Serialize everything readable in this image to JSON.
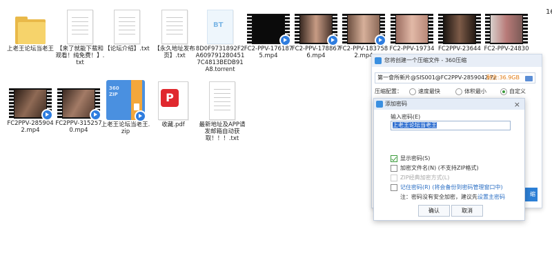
{
  "files": [
    {
      "name": "上老王论坛当老王",
      "type": "folder"
    },
    {
      "name": "【来了就能下载和观看！纯免费！】.txt",
      "type": "txt"
    },
    {
      "name": "【论坛介绍】.txt",
      "type": "txt"
    },
    {
      "name": "【永久地址发布页】.txt",
      "type": "txt"
    },
    {
      "name": "8D0F9731892F2A6097912804517C4813BEDB91A8.torrent",
      "type": "torrent"
    },
    {
      "name": "FC2-PPV-1761875.mp4",
      "type": "video"
    },
    {
      "name": "FC2-PPV-1788676.mp4",
      "type": "video"
    },
    {
      "name": "FC2-PPV-1837582.mp4",
      "type": "video"
    },
    {
      "name": "FC2-PPV-19734",
      "type": "video"
    },
    {
      "name": "FC2PPV-23644",
      "type": "video"
    },
    {
      "name": "FC2-PPV-24830",
      "type": "video"
    },
    {
      "name": "FC2PPV-2859042.mp4",
      "type": "video"
    },
    {
      "name": "FC2PPV-3152570.mp4",
      "type": "video"
    },
    {
      "name": "上老王论坛当老王.zip",
      "type": "zip"
    },
    {
      "name": "收藏.pdf",
      "type": "pdf"
    },
    {
      "name": "最新地址及APP请发邮箱自动获取！！！.txt",
      "type": "txt"
    }
  ],
  "corner_number": "16",
  "torrent_icon_text": "BT",
  "zip_icon_text": "360 ZIP",
  "compress_dialog": {
    "title": "您将创建一个压缩文件 - 360压缩",
    "path": "第一會所新片@SIS001@FC2PPV-2859042.7z",
    "size": "剩余:36.9GB",
    "config_label": "压缩配置：",
    "options": [
      {
        "label": "速度最快",
        "selected": false
      },
      {
        "label": "体积最小",
        "selected": false
      },
      {
        "label": "自定义",
        "selected": true
      }
    ],
    "side_button": "缩"
  },
  "password_dialog": {
    "title": "添加密码",
    "close": "×",
    "prompt": "输入密码(E)",
    "password": "上老王论坛当老王",
    "checks": [
      {
        "label": "显示密码(S)",
        "checked": true,
        "disabled": false
      },
      {
        "label": "加密文件名(N) (不支持ZIP格式)",
        "checked": false,
        "disabled": false
      },
      {
        "label": "ZIP经典加密方式(L)",
        "checked": false,
        "disabled": true
      },
      {
        "label": "记住密码(R) (将会备份到密码管理窗口中)",
        "checked": false,
        "disabled": false,
        "link": true
      }
    ],
    "note": "注：密码没有安全加密，建议先",
    "note_link": "设置主密码",
    "ok": "确认",
    "cancel": "取消"
  },
  "colors": {
    "accent": "#2c7fd6",
    "size": "#e07a12",
    "folder": "#e9b949"
  }
}
